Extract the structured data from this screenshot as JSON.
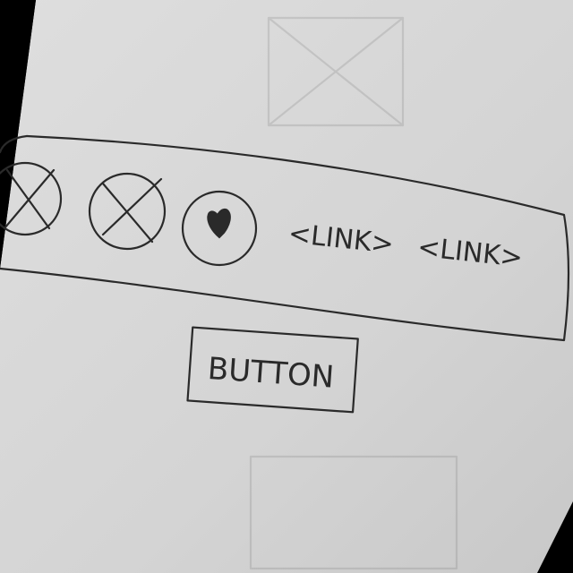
{
  "sketch": {
    "icons": [
      {
        "name": "placeholder-image-icon",
        "glyph": "circle-x"
      },
      {
        "name": "placeholder-image-icon",
        "glyph": "circle-x"
      },
      {
        "name": "heart-icon",
        "glyph": "heart"
      }
    ],
    "links": [
      "<LINK>",
      "<LINK>"
    ],
    "button_label": "BUTTON"
  },
  "colors": {
    "paper": "#d9d9d9",
    "ink": "#2a2a2a",
    "background": "#000000"
  }
}
